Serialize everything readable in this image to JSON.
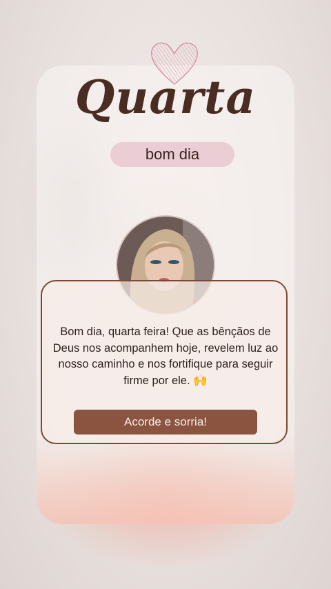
{
  "title": "Quarta",
  "subtitle": "bom dia",
  "message": "Bom dia, quarta feira! Que as bênçãos de Deus nos acompanhem hoje, revelem luz ao nosso caminho e nos fortifique para seguir firme por ele. 🙌",
  "cta_label": "Acorde e sorria!",
  "colors": {
    "title": "#4a2c22",
    "accent_button": "#8a5440",
    "pill": "#e8c4ce",
    "border": "#7a4a38"
  },
  "icons": [
    "heart-icon",
    "praying-hands-emoji"
  ]
}
